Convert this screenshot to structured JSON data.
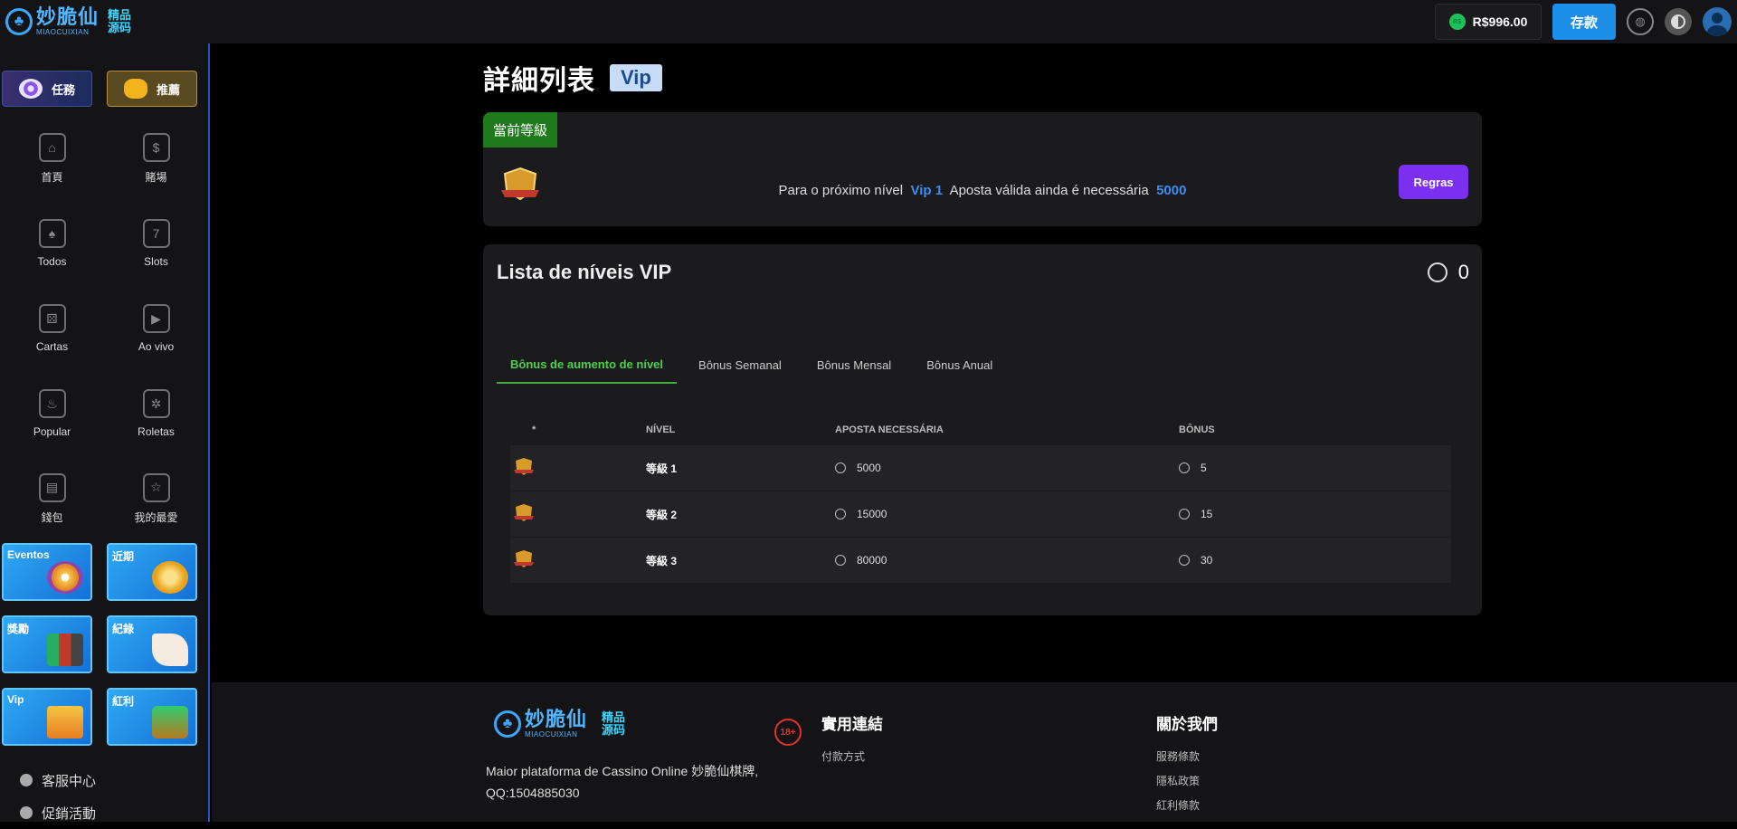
{
  "header": {
    "logo_cn": "妙脆仙",
    "logo_en": "MIAOCUIXIAN",
    "logo_tag_top": "精品",
    "logo_tag_bottom": "源码",
    "coin_symbol": "R$",
    "balance": "R$996.00",
    "deposit_label": "存款",
    "icons": [
      "globe-icon",
      "contrast-icon",
      "avatar-icon"
    ]
  },
  "sidebar": {
    "promos": [
      {
        "label": "任務",
        "icon": "target-icon"
      },
      {
        "label": "推薦",
        "icon": "gift-coins-icon"
      }
    ],
    "nav": [
      {
        "label": "首頁",
        "icon": "home-icon",
        "glyph": "⌂"
      },
      {
        "label": "賭場",
        "icon": "money-bag-icon",
        "glyph": "$"
      },
      {
        "label": "Todos",
        "icon": "cards-icon",
        "glyph": "♠"
      },
      {
        "label": "Slots",
        "icon": "slot-machine-icon",
        "glyph": "7"
      },
      {
        "label": "Cartas",
        "icon": "dice-icon",
        "glyph": "⚄"
      },
      {
        "label": "Ao vivo",
        "icon": "live-tv-icon",
        "glyph": "▶"
      },
      {
        "label": "Popular",
        "icon": "flame-icon",
        "glyph": "♨"
      },
      {
        "label": "Roletas",
        "icon": "roulette-icon",
        "glyph": "✲"
      },
      {
        "label": "錢包",
        "icon": "wallet-icon",
        "glyph": "▤"
      },
      {
        "label": "我的最愛",
        "icon": "favorite-folder-icon",
        "glyph": "☆"
      }
    ],
    "cards": [
      {
        "label": "Eventos",
        "art": "#f2c94c"
      },
      {
        "label": "近期",
        "art": "#e9a21a"
      },
      {
        "label": "獎勵",
        "art": "#c0392b"
      },
      {
        "label": "紀錄",
        "art": "#f0e0d0"
      },
      {
        "label": "Vip",
        "art": "#f39c12"
      },
      {
        "label": "紅利",
        "art": "#27ae60"
      }
    ],
    "links": [
      {
        "label": "客服中心",
        "icon": "headset-icon"
      },
      {
        "label": "促銷活動",
        "icon": "user-promo-icon"
      }
    ]
  },
  "main": {
    "title": "詳細列表",
    "badge": "Vip",
    "current": {
      "tag": "當前等級",
      "text_prefix": "Para o próximo nível",
      "next_level": "Vip 1",
      "text_middle": "Aposta válida ainda é necessária",
      "required": "5000",
      "rules_label": "Regras"
    },
    "list": {
      "title": "Lista de níveis VIP",
      "coin_count": "0",
      "tabs": [
        "Bônus de aumento de nível",
        "Bônus Semanal",
        "Bônus Mensal",
        "Bônus Anual"
      ],
      "columns": [
        "*",
        "NÍVEL",
        "APOSTA NECESSÁRIA",
        "BÔNUS"
      ],
      "rows": [
        {
          "level": "等級 1",
          "bet": "5000",
          "bonus": "5"
        },
        {
          "level": "等級 2",
          "bet": "15000",
          "bonus": "15"
        },
        {
          "level": "等級 3",
          "bet": "80000",
          "bonus": "30"
        }
      ]
    }
  },
  "footer": {
    "description_line1": "Maior plataforma de Cassino Online 妙脆仙棋牌,",
    "description_line2": "QQ:1504885030",
    "age_badge": "18+",
    "col1": {
      "title": "實用連結",
      "links": [
        "付款方式"
      ]
    },
    "col2": {
      "title": "關於我們",
      "links": [
        "服務條款",
        "隱私政策",
        "紅利條款"
      ]
    }
  },
  "colors": {
    "accent_blue": "#1e8fe8",
    "accent_green": "#3fae3a",
    "accent_purple": "#7b2ff0",
    "highlight_blue": "#3a8ef2"
  }
}
